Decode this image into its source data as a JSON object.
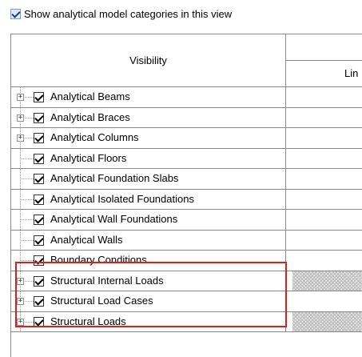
{
  "show_analytical": {
    "label": "Show analytical model categories in this view",
    "checked": true
  },
  "grid": {
    "header_visibility": "Visibility",
    "header_right_sub": "Lin",
    "rows": [
      {
        "label": "Analytical Beams",
        "expandable": true,
        "checked": true,
        "hatched": false
      },
      {
        "label": "Analytical Braces",
        "expandable": true,
        "checked": true,
        "hatched": false
      },
      {
        "label": "Analytical Columns",
        "expandable": true,
        "checked": true,
        "hatched": false
      },
      {
        "label": "Analytical Floors",
        "expandable": false,
        "checked": true,
        "hatched": false
      },
      {
        "label": "Analytical Foundation Slabs",
        "expandable": false,
        "checked": true,
        "hatched": false
      },
      {
        "label": "Analytical Isolated Foundations",
        "expandable": false,
        "checked": true,
        "hatched": false
      },
      {
        "label": "Analytical Wall Foundations",
        "expandable": false,
        "checked": true,
        "hatched": false
      },
      {
        "label": "Analytical Walls",
        "expandable": false,
        "checked": true,
        "hatched": false
      },
      {
        "label": "Boundary Conditions",
        "expandable": false,
        "checked": true,
        "hatched": false
      },
      {
        "label": "Structural Internal Loads",
        "expandable": true,
        "checked": true,
        "hatched": true
      },
      {
        "label": "Structural Load Cases",
        "expandable": true,
        "checked": true,
        "hatched": false
      },
      {
        "label": "Structural Loads",
        "expandable": true,
        "checked": true,
        "hatched": true
      }
    ]
  },
  "colors": {
    "highlight": "#e41b1b",
    "grid_line": "#8a8a8a"
  }
}
